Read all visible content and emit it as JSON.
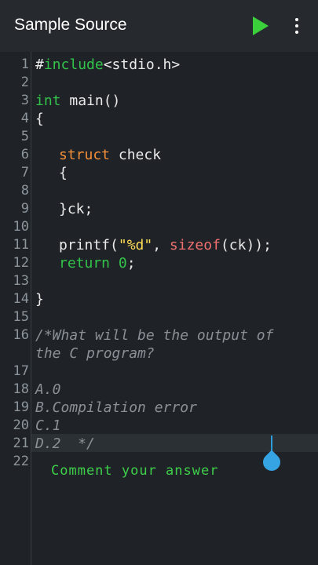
{
  "appbar": {
    "title": "Sample Source",
    "run_icon": "play-icon",
    "menu_icon": "more-vert-icon"
  },
  "editor": {
    "line_numbers": [
      "1",
      "2",
      "3",
      "4",
      "5",
      "6",
      "7",
      "8",
      "9",
      "10",
      "11",
      "12",
      "13",
      "14",
      "15",
      "16",
      "17",
      "18",
      "19",
      "20",
      "21",
      "22"
    ],
    "code": {
      "l1_a": "#",
      "l1_b": "include",
      "l1_c": "<stdio.h>",
      "l3_a": "int",
      "l3_b": " main()",
      "l4": "{",
      "l6_a": "struct",
      "l6_b": " check",
      "l7": "{",
      "l9": "}ck;",
      "l11_a": "printf(",
      "l11_b": "\"%d\"",
      "l11_c": ", ",
      "l11_d": "sizeof",
      "l11_e": "(ck));",
      "l12_a": "return",
      "l12_b": " ",
      "l12_c": "0",
      "l12_d": ";",
      "l14": "}",
      "l16": "/*What will be the output of the C program?",
      "l18": "A.0",
      "l19": "B.Compilation error",
      "l20": "C.1",
      "l21": "D.2  */"
    }
  },
  "overlay_text": "Comment your answer",
  "colors": {
    "background": "#1f2327",
    "keyword": "#f08e3a",
    "green": "#33c24a",
    "string": "#ffdd55",
    "function": "#f07070",
    "comment": "#8a9096",
    "caret": "#36a4e2"
  }
}
